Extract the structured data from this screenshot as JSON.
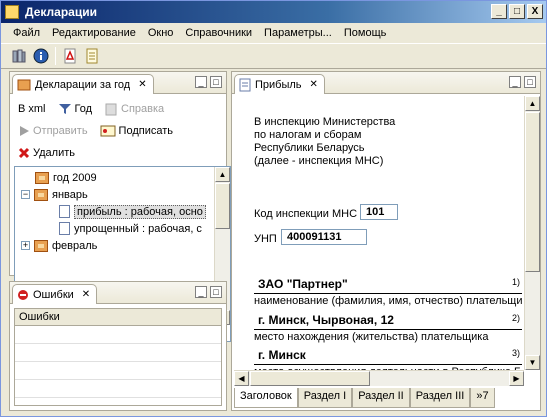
{
  "window": {
    "title": "Декларации",
    "buttons": [
      "_",
      "□",
      "X"
    ]
  },
  "menu": [
    "Файл",
    "Редактирование",
    "Окно",
    "Справочники",
    "Параметры...",
    "Помощь"
  ],
  "declarations_view": {
    "tab_label": "Декларации за год",
    "actions": {
      "to_xml": "В xml",
      "year": "Год",
      "help": "Справка",
      "send": "Отправить",
      "sign": "Подписать",
      "delete": "Удалить"
    },
    "tree": [
      {
        "label": "год 2009",
        "level": 0
      },
      {
        "label": "январь",
        "level": 1
      },
      {
        "label": "прибыль : рабочая,  осно",
        "level": 2
      },
      {
        "label": "упрощенный : рабочая,  с",
        "level": 2
      },
      {
        "label": "февраль",
        "level": 1
      }
    ]
  },
  "errors_view": {
    "tab_label": "Ошибки",
    "column": "Ошибки"
  },
  "editor": {
    "tab_label": "Прибыль",
    "address": [
      "В инспекцию Министерства",
      "по налогам и сборам",
      "Республики Беларусь",
      "(далее - инспекция МНС)"
    ],
    "mns_label": "Код инспекции МНС",
    "mns_code": "101",
    "unp_label": "УНП",
    "unp_value": "400091131",
    "org_name": "ЗАО \"Партнер\"",
    "org_caption": "наименование (фамилия, имя, отчество) плательщи",
    "location": "г. Минск, Чырвоная, 12",
    "location_caption": "место нахождения (жительства) плательщика",
    "activity": "г. Минск",
    "activity_caption": "место осуществления деятельности в Республике Б",
    "superscripts": [
      "1)",
      "2)",
      "3)"
    ],
    "bottom_tabs": [
      "Заголовок",
      "Раздел I",
      "Раздел II",
      "Раздел III",
      "»7"
    ]
  }
}
